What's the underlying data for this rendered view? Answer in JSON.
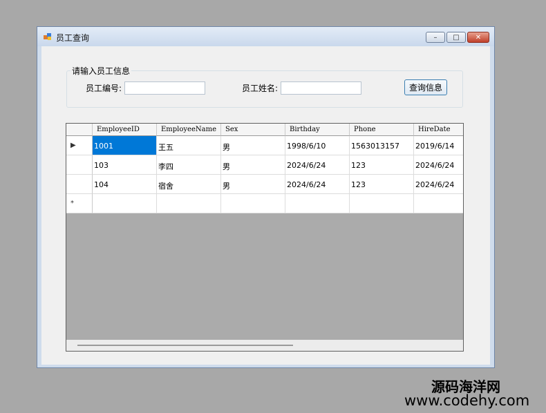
{
  "window": {
    "title": "员工查询",
    "min_symbol": "–",
    "max_symbol": "□",
    "close_symbol": "✕"
  },
  "search": {
    "group_label": "请输入员工信息",
    "id_label": "员工编号:",
    "id_value": "",
    "name_label": "员工姓名:",
    "name_value": "",
    "query_button": "查询信息"
  },
  "grid": {
    "columns": [
      "EmployeeID",
      "EmployeeName",
      "Sex",
      "Birthday",
      "Phone",
      "HireDate"
    ],
    "rows": [
      [
        "1001",
        "王五",
        "男",
        "1998/6/10",
        "1563013157",
        "2019/6/14"
      ],
      [
        "103",
        "李四",
        "男",
        "2024/6/24",
        "123",
        "2024/6/24"
      ],
      [
        "104",
        "宿舍",
        "男",
        "2024/6/24",
        "123",
        "2024/6/24"
      ]
    ],
    "current_row_marker": "▶",
    "new_row_marker": "*"
  },
  "watermark": {
    "line1": "源码海洋网",
    "line2": "www.codehy.com"
  }
}
